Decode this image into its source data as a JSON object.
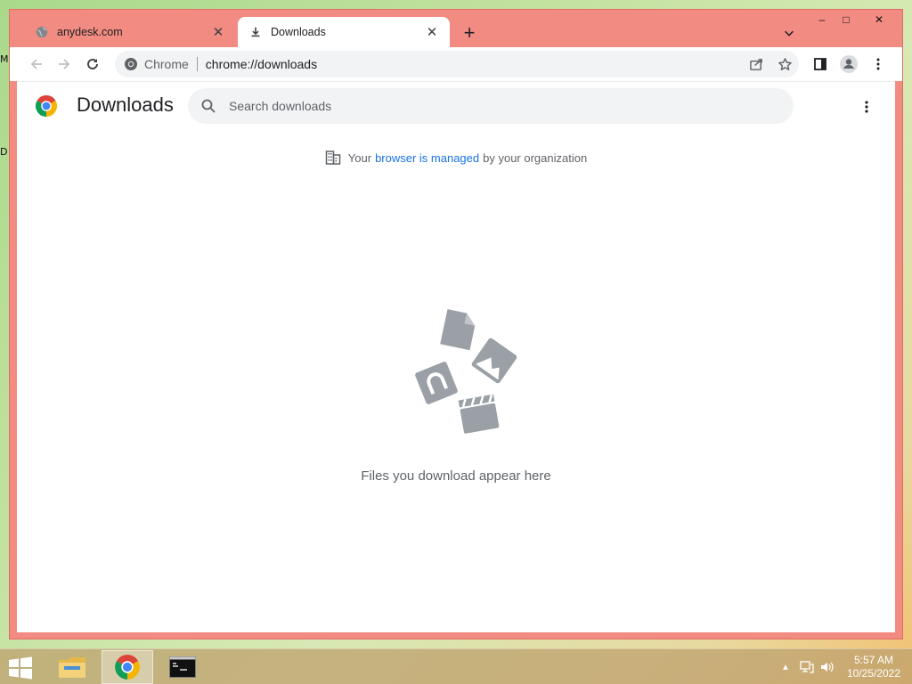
{
  "desktop": {
    "label_m": "M",
    "label_d": "D"
  },
  "browser": {
    "tabs": [
      {
        "title": "anydesk.com",
        "active": false
      },
      {
        "title": "Downloads",
        "active": true
      }
    ],
    "new_tab": "+",
    "window_controls": {
      "minimize": "–",
      "maximize": "□",
      "close": "✕"
    },
    "omnibox": {
      "site_chip": "Chrome",
      "url": "chrome://downloads"
    }
  },
  "downloads_page": {
    "title": "Downloads",
    "search_placeholder": "Search downloads",
    "managed_notice": {
      "prefix": "Your",
      "link": "browser is managed",
      "suffix": "by your organization"
    },
    "empty_message": "Files you download appear here"
  },
  "taskbar": {
    "clock_time": "5:57 AM",
    "clock_date": "10/25/2022",
    "tray_expand": "▲"
  },
  "colors": {
    "frame": "#f28b82",
    "link": "#1a73e8",
    "icon_gray": "#9aa0a6",
    "text_secondary": "#5f6368"
  }
}
